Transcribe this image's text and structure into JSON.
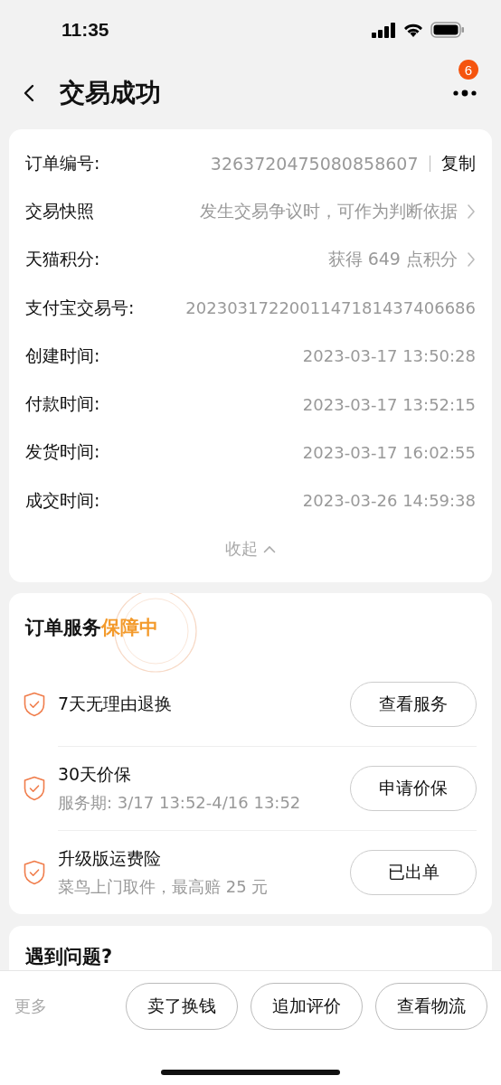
{
  "status_bar": {
    "time": "11:35"
  },
  "nav": {
    "title": "交易成功",
    "badge": "6"
  },
  "order_info": {
    "rows": [
      {
        "label": "订单编号:",
        "value": "3263720475080858607",
        "kind": "copy",
        "action": "复制"
      },
      {
        "label": "交易快照",
        "value": "发生交易争议时，可作为判断依据",
        "kind": "link"
      },
      {
        "label": "天猫积分:",
        "value": "获得 649 点积分",
        "kind": "link"
      },
      {
        "label": "支付宝交易号:",
        "value": "2023031722001147181437406686",
        "kind": "plain"
      },
      {
        "label": "创建时间:",
        "value": "2023-03-17 13:50:28",
        "kind": "plain"
      },
      {
        "label": "付款时间:",
        "value": "2023-03-17 13:52:15",
        "kind": "plain"
      },
      {
        "label": "发货时间:",
        "value": "2023-03-17 16:02:55",
        "kind": "plain"
      },
      {
        "label": "成交时间:",
        "value": "2023-03-26 14:59:38",
        "kind": "plain"
      }
    ],
    "collapse": "收起"
  },
  "services": {
    "title": "订单服务",
    "status": "保障中",
    "items": [
      {
        "name": "7天无理由退换",
        "button": "查看服务"
      },
      {
        "name": "30天价保",
        "detail": "服务期: 3/17 13:52-4/16 13:52",
        "button": "申请价保"
      },
      {
        "name": "升级版运费险",
        "detail": "菜鸟上门取件，最高赔 25 元",
        "button": "已出单"
      }
    ]
  },
  "help": {
    "title": "遇到问题?"
  },
  "action_bar": {
    "more": "更多",
    "buttons": [
      "卖了换钱",
      "追加评价",
      "查看物流"
    ]
  }
}
